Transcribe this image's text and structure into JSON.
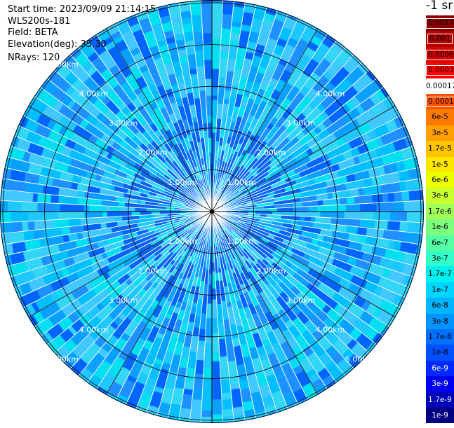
{
  "info": {
    "start_time": "Start time: 2023/09/09 21:14:15",
    "instrument": "WLS200s-181",
    "field": "Field: BETA",
    "elevation": "Elevation(deg): 35.30",
    "nrays": "NRays: 120"
  },
  "colorbar": {
    "unit": "-1 sr",
    "ticks": [
      {
        "label": "0.0017",
        "color": "#8b0000",
        "text_color": "#000000",
        "boxed": true
      },
      {
        "label": "0.001",
        "color": "#b00000",
        "text_color": "#000000",
        "boxed": true
      },
      {
        "label": "0.0006",
        "color": "#d40000",
        "text_color": "#000000",
        "boxed": true
      },
      {
        "label": "0.0003",
        "color": "#ff0000",
        "text_color": "#000000",
        "boxed": true
      },
      {
        "label": "0.00017",
        "color": "#ffffff",
        "text_color": "#000000",
        "boxed": false
      },
      {
        "label": "0.0001",
        "color": "#ff5000",
        "text_color": "#000000",
        "boxed": true
      },
      {
        "label": "6e-5",
        "color": "#ff7a00",
        "text_color": "#000000",
        "boxed": false
      },
      {
        "label": "3e-5",
        "color": "#ff9f00",
        "text_color": "#000000",
        "boxed": false
      },
      {
        "label": "1.7e-5",
        "color": "#ffc400",
        "text_color": "#000000",
        "boxed": false
      },
      {
        "label": "1e-5",
        "color": "#ffe800",
        "text_color": "#000000",
        "boxed": false
      },
      {
        "label": "6e-6",
        "color": "#ecff00",
        "text_color": "#000000",
        "boxed": false
      },
      {
        "label": "3e-6",
        "color": "#c8ff2e",
        "text_color": "#000000",
        "boxed": false
      },
      {
        "label": "1.7e-6",
        "color": "#a0ff58",
        "text_color": "#000000",
        "boxed": false
      },
      {
        "label": "1e-6",
        "color": "#7cff7c",
        "text_color": "#000000",
        "boxed": false
      },
      {
        "label": "6e-7",
        "color": "#55ffa4",
        "text_color": "#000000",
        "boxed": false
      },
      {
        "label": "3e-7",
        "color": "#33ffc8",
        "text_color": "#000000",
        "boxed": false
      },
      {
        "label": "1.7e-7",
        "color": "#00f0f0",
        "text_color": "#000000",
        "boxed": false
      },
      {
        "label": "1e-7",
        "color": "#00d4ff",
        "text_color": "#000000",
        "boxed": false
      },
      {
        "label": "6e-8",
        "color": "#00b4ff",
        "text_color": "#000000",
        "boxed": false
      },
      {
        "label": "3e-8",
        "color": "#0094ff",
        "text_color": "#000000",
        "boxed": false
      },
      {
        "label": "1.7e-8",
        "color": "#0070ff",
        "text_color": "#000000",
        "boxed": false
      },
      {
        "label": "1e-8",
        "color": "#0050ff",
        "text_color": "#000000",
        "boxed": false
      },
      {
        "label": "6e-9",
        "color": "#0028ff",
        "text_color": "#ffffff",
        "boxed": false
      },
      {
        "label": "3e-9",
        "color": "#0000ee",
        "text_color": "#ffffff",
        "boxed": false
      },
      {
        "label": "1.7e-9",
        "color": "#0000b8",
        "text_color": "#ffffff",
        "boxed": false
      },
      {
        "label": "1e-9",
        "color": "#000080",
        "text_color": "#ffffff",
        "boxed": false
      }
    ]
  },
  "range_rings": {
    "labels": [
      "1.00km",
      "2.00km",
      "3.00km",
      "4.00km",
      "5.00km"
    ]
  },
  "colors": {
    "background": "#ffffff",
    "data_palette": [
      "#00bfff",
      "#1ec8ff",
      "#0aa0ff",
      "#33d6f5",
      "#1e90ff",
      "#0064ff",
      "#40c8ff",
      "#00e0f0"
    ],
    "ring_line": "#000000",
    "ring_label": "#ffffff"
  }
}
